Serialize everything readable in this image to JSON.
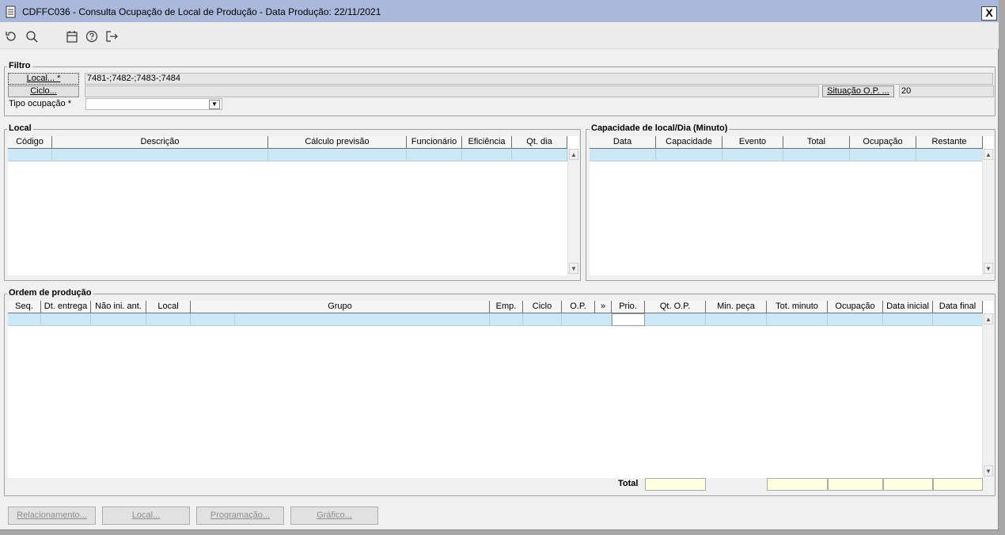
{
  "window": {
    "title": "CDFFC036 - Consulta Ocupação de Local de Produção - Data Produção: 22/11/2021",
    "close": "X"
  },
  "toolbar": {
    "icons": [
      "refresh-icon",
      "search-icon",
      "calendar-icon",
      "help-icon",
      "exit-icon"
    ]
  },
  "filtro": {
    "title": "Filtro",
    "local_button": "Local... *",
    "local_value": "7481-;7482-;7483-;7484",
    "ciclo_button": "Ciclo...",
    "ciclo_value": "",
    "situacao_button": "Situação O.P. ...",
    "situacao_value": "20",
    "tipo_label": "Tipo ocupação *",
    "tipo_value": ""
  },
  "local_grid": {
    "title": "Local",
    "columns": [
      "Código",
      "Descrição",
      "Cálculo previsão",
      "Funcionário",
      "Eficiência",
      "Qt. dia"
    ]
  },
  "capacidade_grid": {
    "title": "Capacidade de local/Dia (Minuto)",
    "columns": [
      "Data",
      "Capacidade",
      "Evento",
      "Total",
      "Ocupação",
      "Restante"
    ]
  },
  "ordem_grid": {
    "title": "Ordem de produção",
    "columns": [
      "Seq.",
      "Dt. entrega",
      "Não ini. ant.",
      "Local",
      "",
      "Grupo",
      "Emp.",
      "Ciclo",
      "O.P.",
      "»",
      "Prio.",
      "Qt. O.P.",
      "Min. peça",
      "Tot. minuto",
      "Ocupação",
      "Data inicial",
      "Data final"
    ],
    "total_label": "Total"
  },
  "bottom_buttons": {
    "relacionamento": "Relacionamento...",
    "local": "Local...",
    "programacao": "Programação...",
    "grafico": "Gráfico..."
  },
  "colors": {
    "titlebar": "#a9b8db",
    "selected_row": "#cce8f7",
    "total_cell": "#ffffe1"
  }
}
